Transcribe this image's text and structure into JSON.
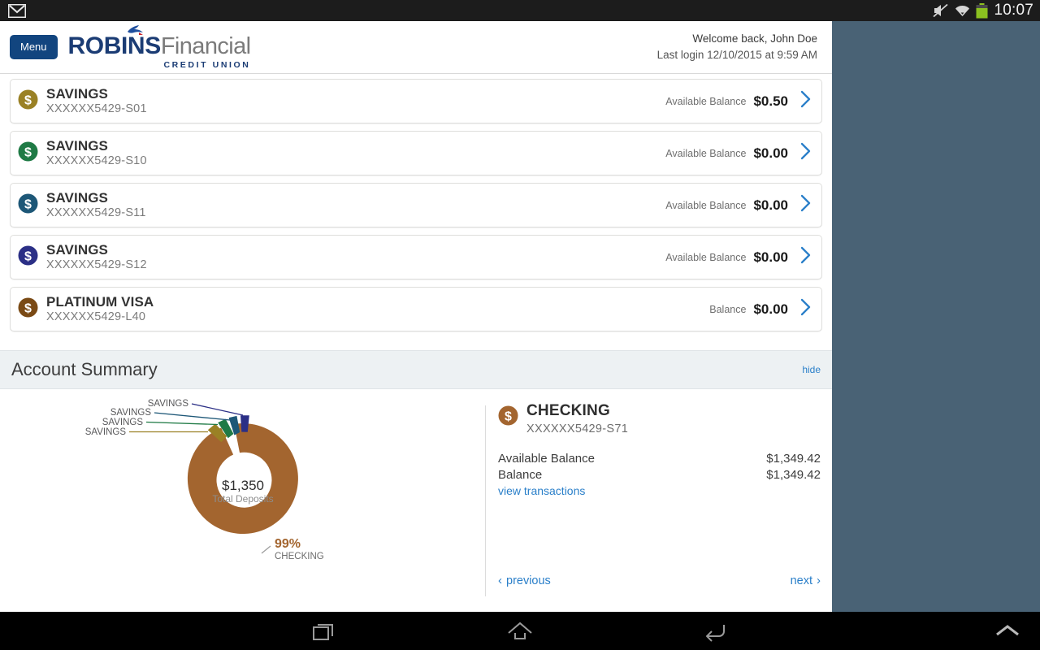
{
  "status_bar": {
    "time": "10:07",
    "icons": [
      "mail-icon",
      "mute-icon",
      "wifi-icon",
      "battery-icon"
    ]
  },
  "header": {
    "menu_label": "Menu",
    "logo": {
      "part1": "ROBINS",
      "part2": "Financial",
      "tagline": "CREDIT UNION"
    },
    "welcome_line": "Welcome back, John Doe",
    "last_login_line": "Last login 12/10/2015 at 9:59 AM"
  },
  "accounts": [
    {
      "name": "SAVINGS",
      "number": "XXXXXX5429-S01",
      "balance_label": "Available Balance",
      "balance": "$0.50",
      "color": "#9a8125"
    },
    {
      "name": "SAVINGS",
      "number": "XXXXXX5429-S10",
      "balance_label": "Available Balance",
      "balance": "$0.00",
      "color": "#1f7a45"
    },
    {
      "name": "SAVINGS",
      "number": "XXXXXX5429-S11",
      "balance_label": "Available Balance",
      "balance": "$0.00",
      "color": "#1d5777"
    },
    {
      "name": "SAVINGS",
      "number": "XXXXXX5429-S12",
      "balance_label": "Available Balance",
      "balance": "$0.00",
      "color": "#2b2f86"
    },
    {
      "name": "PLATINUM VISA",
      "number": "XXXXXX5429-L40",
      "balance_label": "Balance",
      "balance": "$0.00",
      "color": "#7a4a15"
    }
  ],
  "summary": {
    "title": "Account Summary",
    "hide_label": "hide",
    "detail": {
      "name": "CHECKING",
      "number": "XXXXXX5429-S71",
      "icon_color": "#a3652f",
      "available_balance_label": "Available Balance",
      "available_balance": "$1,349.42",
      "balance_label": "Balance",
      "balance": "$1,349.42",
      "view_transactions_label": "view transactions"
    },
    "pager": {
      "previous_label": "previous",
      "next_label": "next"
    }
  },
  "chart_data": {
    "type": "pie",
    "title": "Total Deposits",
    "center_value": "$1,350",
    "center_label": "Total Deposits",
    "categories": [
      "CHECKING",
      "SAVINGS",
      "SAVINGS",
      "SAVINGS",
      "SAVINGS"
    ],
    "values": [
      1349.42,
      0.5,
      0.0,
      0.0,
      0.0
    ],
    "percentages": [
      99,
      1,
      0,
      0,
      0
    ],
    "colors": [
      "#a3652f",
      "#9a8125",
      "#1f7a45",
      "#1d5777",
      "#2b2f86"
    ],
    "callout_main": {
      "percent": "99%",
      "label": "CHECKING"
    },
    "callout_labels": [
      "SAVINGS",
      "SAVINGS",
      "SAVINGS",
      "SAVINGS"
    ],
    "legend": "inline-callouts",
    "grid": false
  },
  "nav_bar": {
    "recents_label": "recents-icon",
    "home_label": "home-icon",
    "back_label": "back-icon",
    "keyboard_label": "chevron-up-icon"
  }
}
